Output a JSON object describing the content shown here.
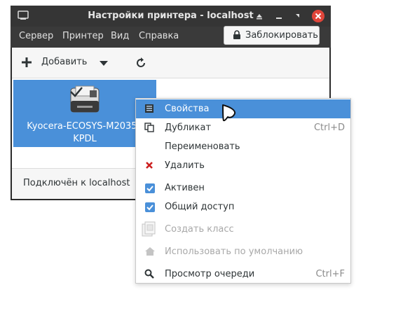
{
  "window": {
    "title": "Настройки принтера - localhost"
  },
  "menubar": {
    "items": [
      "Сервер",
      "Принтер",
      "Вид",
      "Справка"
    ]
  },
  "lock_button": {
    "label": "Заблокировать"
  },
  "toolbar": {
    "add_label": "Добавить"
  },
  "printer": {
    "name_line1": "Kyocera-ECOSYS-M2035d",
    "name_line2": "KPDL"
  },
  "status": {
    "text": "Подключён к localhost"
  },
  "context_menu": {
    "items": [
      {
        "label": "Свойства",
        "shortcut": "",
        "icon": "properties-icon",
        "state": "selected"
      },
      {
        "label": "Дубликат",
        "shortcut": "Ctrl+D",
        "icon": "copy-icon",
        "state": "normal"
      },
      {
        "label": "Переименовать",
        "shortcut": "",
        "icon": "",
        "state": "normal"
      },
      {
        "label": "Удалить",
        "shortcut": "",
        "icon": "delete-icon",
        "state": "normal"
      },
      {
        "label": "Активен",
        "shortcut": "",
        "icon": "checkbox-checked-icon",
        "state": "checked"
      },
      {
        "label": "Общий доступ",
        "shortcut": "",
        "icon": "checkbox-checked-icon",
        "state": "checked"
      },
      {
        "label": "Создать класс",
        "shortcut": "",
        "icon": "create-class-icon",
        "state": "disabled"
      },
      {
        "label": "Использовать по умолчанию",
        "shortcut": "",
        "icon": "home-icon",
        "state": "disabled"
      },
      {
        "label": "Просмотр очереди",
        "shortcut": "Ctrl+F",
        "icon": "search-icon",
        "state": "normal"
      }
    ]
  },
  "colors": {
    "accent": "#4a90d9",
    "titlebar": "#353535",
    "close_button": "#e0453a"
  }
}
